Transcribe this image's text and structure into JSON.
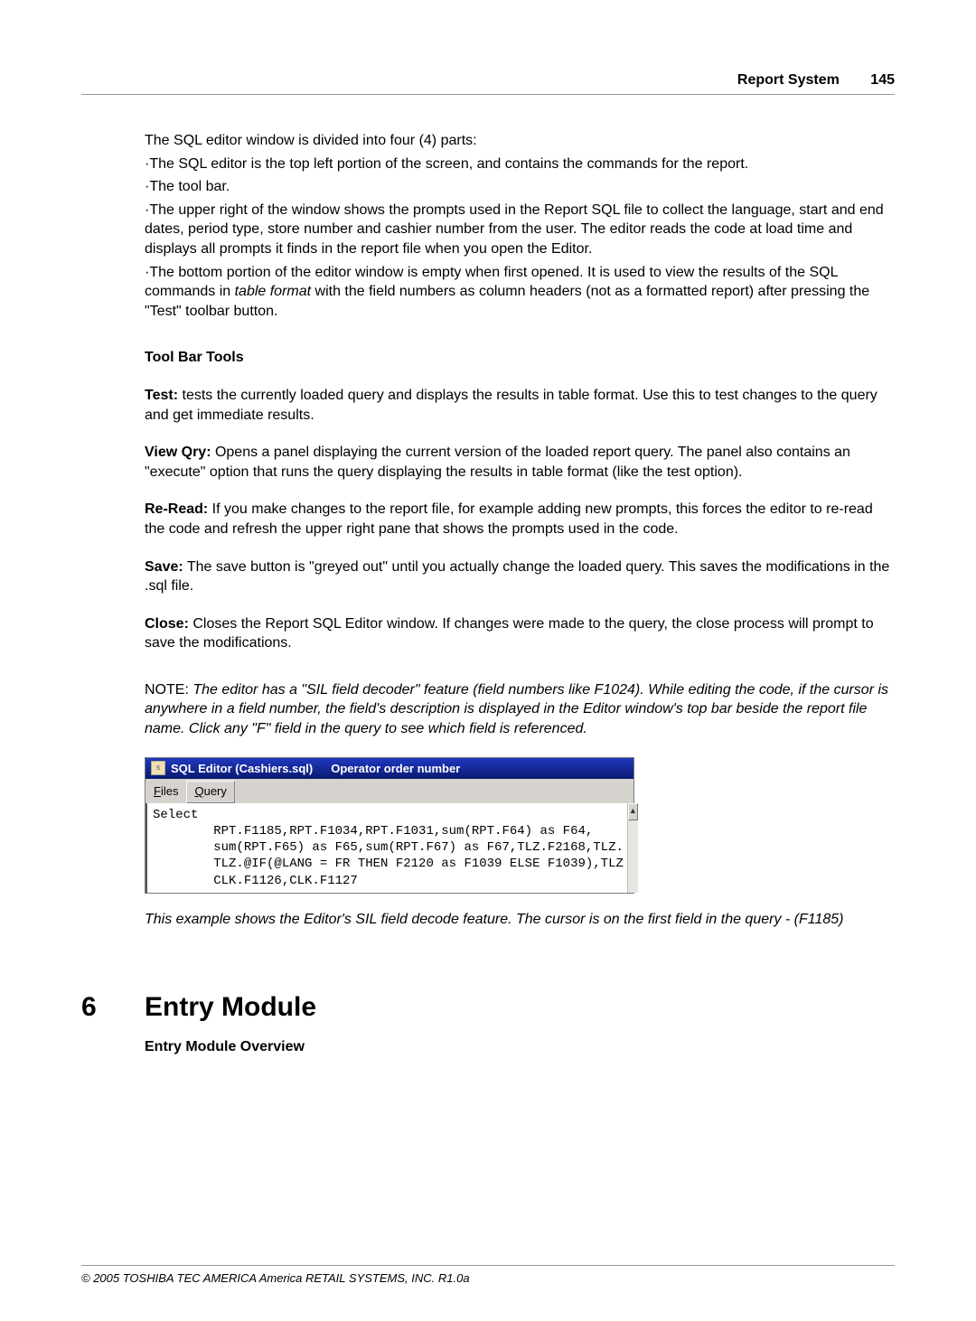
{
  "header": {
    "title": "Report System",
    "page": "145"
  },
  "intro": {
    "line1": " The SQL editor window is divided into four (4) parts:",
    "bullet1": "·The SQL editor is the top left portion of the screen, and contains the commands for the report.",
    "bullet2": "·The tool bar.",
    "bullet3": "·The upper right of the window shows the prompts used in the Report SQL file to collect the language, start and end dates, period type, store number and cashier number from the user. The editor reads the code at load time and displays all prompts it finds in the report file when you open the Editor.",
    "bullet4a": "·The bottom portion of the editor window is empty when first opened. It is used to view the results of the SQL commands in ",
    "bullet4b_italic": "table format",
    "bullet4c": "  with the field numbers as column headers (not as a formatted report) after pressing the \"Test\" toolbar button."
  },
  "toolbar": {
    "heading": "Tool Bar Tools",
    "test_label": "Test:",
    "test_text": "  tests the currently loaded query and displays the results in table format. Use this to test changes to the query and get immediate results.",
    "view_label": "View Qry:",
    "view_text": "  Opens a panel displaying the current version of the loaded report query. The panel also contains an \"execute\" option that runs the query displaying the results in table format (like the test option).",
    "reread_label": "Re-Read:",
    "reread_text": "  If you make changes to the report file, for example adding new prompts, this forces the editor to re-read the code and refresh the upper right pane that shows the prompts used in the code.",
    "save_label": "Save:",
    "save_text": "  The save button is \"greyed out\" until you actually change the loaded query. This saves the modifications in the .sql file.",
    "close_label": "Close:",
    "close_text": "  Closes the Report SQL Editor window. If changes were made to the query, the close process will prompt to save the modifications."
  },
  "note": {
    "prefix": "NOTE: ",
    "text": "The editor has a \"SIL field decoder\" feature (field numbers like F1024). While editing the code, if the cursor is anywhere in a field number, the field's description is displayed in the Editor window's top bar beside the report file name. Click any \"F\" field in the query to see which field is referenced."
  },
  "editor": {
    "title1": "SQL Editor (Cashiers.sql)",
    "title2": "Operator order number",
    "menu_files_u": "F",
    "menu_files_rest": "iles",
    "menu_query_u": "Q",
    "menu_query_rest": "uery",
    "code_line1": "Select",
    "code_line2": "        RPT.F1185,RPT.F1034,RPT.F1031,sum(RPT.F64) as F64,",
    "code_line3": "        sum(RPT.F65) as F65,sum(RPT.F67) as F67,TLZ.F2168,TLZ.",
    "code_line4": "        TLZ.@IF(@LANG = FR THEN F2120 as F1039 ELSE F1039),TLZ",
    "code_line5": "        CLK.F1126,CLK.F1127",
    "scroll_up": "▲"
  },
  "caption": "This example shows the Editor's SIL field decode feature. The cursor is on the first field in the query - (F1185)",
  "section6": {
    "num": "6",
    "title": "Entry Module",
    "sub": "Entry Module Overview"
  },
  "footer": "© 2005 TOSHIBA TEC AMERICA America RETAIL SYSTEMS, INC.   R1.0a"
}
